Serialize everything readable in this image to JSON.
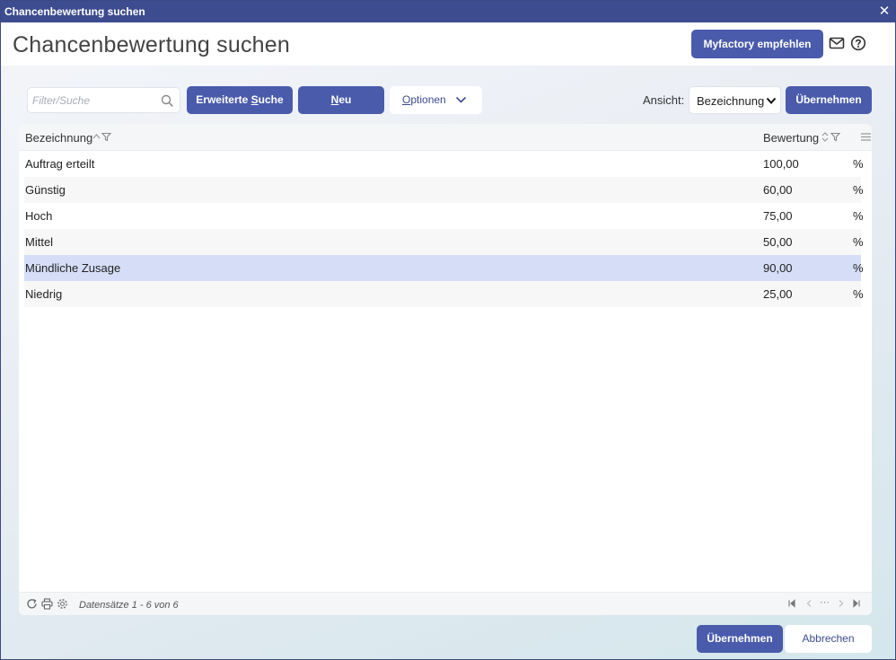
{
  "window": {
    "title": "Chancenbewertung suchen"
  },
  "header": {
    "title": "Chancenbewertung suchen",
    "recommend_label": "Myfactory empfehlen"
  },
  "toolbar": {
    "search_placeholder": "Filter/Suche",
    "extended_pre": "Erweiterte ",
    "extended_key": "S",
    "extended_post": "uche",
    "new_key": "N",
    "new_post": "eu",
    "options_key": "O",
    "options_post": "ptionen",
    "view_label": "Ansicht:",
    "view_value": "Bezeichnung",
    "apply_label": "Übernehmen"
  },
  "grid": {
    "columns": [
      "Bezeichnung",
      "Bewertung"
    ],
    "rows": [
      {
        "name": "Auftrag erteilt",
        "value": "100,00",
        "unit": "%",
        "selected": false
      },
      {
        "name": "Günstig",
        "value": "60,00",
        "unit": "%",
        "selected": false
      },
      {
        "name": "Hoch",
        "value": "75,00",
        "unit": "%",
        "selected": false
      },
      {
        "name": "Mittel",
        "value": "50,00",
        "unit": "%",
        "selected": false
      },
      {
        "name": "Mündliche Zusage",
        "value": "90,00",
        "unit": "%",
        "selected": true
      },
      {
        "name": "Niedrig",
        "value": "25,00",
        "unit": "%",
        "selected": false
      }
    ],
    "records_text": "Datensätze 1 - 6 von 6",
    "pager_ellipsis": "···"
  },
  "footer": {
    "ok_label": "Übernehmen",
    "cancel_label": "Abbrechen"
  },
  "colors": {
    "titlebar": "#3d4c8f",
    "primary": "#4a5bab",
    "selected_row": "#d5def6"
  }
}
